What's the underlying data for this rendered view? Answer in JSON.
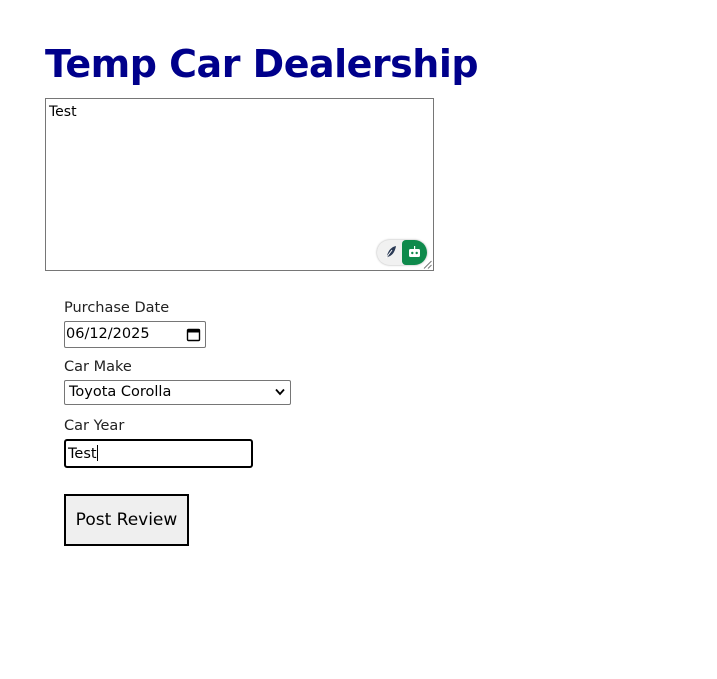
{
  "page": {
    "title": "Temp Car Dealership"
  },
  "review": {
    "text": "Test"
  },
  "form": {
    "purchase_date_label": "Purchase Date",
    "purchase_date_value": "06/12/2025",
    "car_make_label": "Car Make",
    "car_make_selected": "Toyota Corolla",
    "car_year_label": "Car Year",
    "car_year_value": "Test",
    "submit_label": "Post Review"
  },
  "icons": {
    "feather": "feather-icon",
    "bot": "bot-icon",
    "calendar": "calendar-icon",
    "dropdown": "chevron-down-icon",
    "resize": "resize-grip-icon"
  },
  "colors": {
    "title": "#00008b",
    "extension_green": "#0f8a4c",
    "button_bg": "#efefef"
  }
}
